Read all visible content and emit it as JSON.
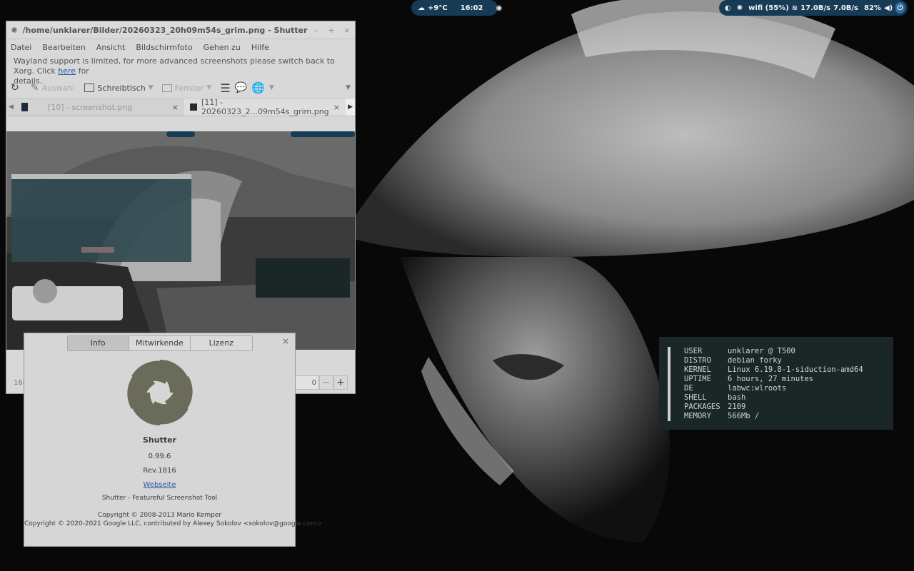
{
  "panel": {
    "weather": "+9°C",
    "clock": "16:02",
    "wifi": "wifi (55%)",
    "down_rate": "17.0B/s",
    "up_rate": "7.0B/s",
    "battery": "82%"
  },
  "shutter": {
    "title": "/home/unklarer/Bilder/20260323_20h09m54s_grim.png - Shutter",
    "menu": [
      "Datei",
      "Bearbeiten",
      "Ansicht",
      "Bildschirmfoto",
      "Gehen zu",
      "Hilfe"
    ],
    "notice_text": "Wayland support is limited, for more advanced screenshots please switch back to Xorg. Click",
    "notice_link": "here",
    "notice_tail": "for",
    "notice_tail2": "details.",
    "toolbar": {
      "selection": "Auswahl",
      "desktop": "Schreibtisch",
      "window": "Fenster"
    },
    "tabs": [
      "[10] - screenshot.png",
      "[11] - 20260323_2...09m54s_grim.png"
    ],
    "status_left": "168",
    "zoom_value": "0"
  },
  "about": {
    "tabs": [
      "Info",
      "Mitwirkende",
      "Lizenz"
    ],
    "app_name": "Shutter",
    "version": "0.99.6",
    "revision": "Rev.1816",
    "website": "Webseite",
    "tagline": "Shutter - Featureful Screenshot Tool",
    "copyright1": "Copyright © 2008-2013 Mario Kemper",
    "copyright2": "Copyright © 2020-2021 Google LLC, contributed by Alexey Sokolov <sokolov@google.com>"
  },
  "terminal": {
    "rows": [
      {
        "key": "USER",
        "value": "unklarer @ T500"
      },
      {
        "key": "DISTRO",
        "value": "debian forky"
      },
      {
        "key": "KERNEL",
        "value": "Linux 6.19.8-1-siduction-amd64"
      },
      {
        "key": "UPTIME",
        "value": "6 hours, 27 minutes"
      },
      {
        "key": "DE",
        "value": "labwc:wlroots"
      },
      {
        "key": "SHELL",
        "value": "bash"
      },
      {
        "key": "PACKAGES",
        "value": "2109"
      },
      {
        "key": "MEMORY",
        "value": "566Mb /"
      }
    ]
  },
  "colors": {
    "panel_pill": "#173a55",
    "terminal_bg": "#1b2626",
    "link": "#2a57a6"
  }
}
